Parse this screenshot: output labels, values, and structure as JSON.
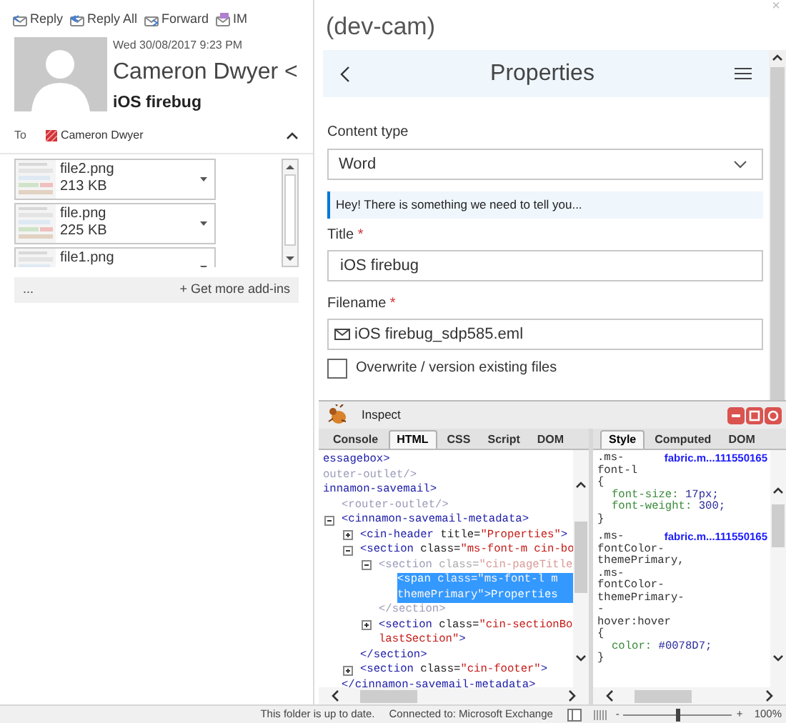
{
  "toolbar": [
    {
      "kind": "reply",
      "label": "Reply"
    },
    {
      "kind": "reply-all",
      "label": "Reply All"
    },
    {
      "kind": "forward",
      "label": "Forward"
    },
    {
      "kind": "im",
      "label": "IM"
    }
  ],
  "message": {
    "date": "Wed 30/08/2017 9:23 PM",
    "sender": "Cameron Dwyer <",
    "subject": "iOS firebug",
    "to_label": "To",
    "recipient": "Cameron Dwyer"
  },
  "attachments": [
    {
      "name": "file2.png",
      "size": "213 KB"
    },
    {
      "name": "file.png",
      "size": "225 KB"
    },
    {
      "name": "file1.png"
    }
  ],
  "addins": {
    "more": "...",
    "label": "+ Get more add-ins"
  },
  "addin_pane": {
    "title": "(dev-cam)",
    "close": "×",
    "header": "Properties",
    "fields": [
      {
        "kind": "select",
        "label": "Content type",
        "value": "Word"
      },
      {
        "kind": "message",
        "text": "Hey! There is something we need to tell you..."
      },
      {
        "kind": "text",
        "label": "Title",
        "required_mark": "*",
        "value": "iOS firebug"
      },
      {
        "kind": "file",
        "label": "Filename",
        "required_mark": "*",
        "value": "iOS firebug_sdp585.eml"
      },
      {
        "kind": "checkbox",
        "label": "Overwrite / version existing files",
        "checked": false
      }
    ]
  },
  "firebug": {
    "title": "Inspect",
    "tabs": [
      {
        "label": "Console",
        "selected": false
      },
      {
        "label": "HTML",
        "selected": true
      },
      {
        "label": "CSS",
        "selected": false
      },
      {
        "label": "Script",
        "selected": false
      },
      {
        "label": "DOM",
        "selected": false
      }
    ],
    "side_tabs": [
      {
        "label": "Style",
        "selected": true
      },
      {
        "label": "Computed",
        "selected": false
      },
      {
        "label": "DOM",
        "selected": false
      }
    ],
    "tree": [
      {
        "dim": false,
        "selected": false,
        "lines": [
          [
            {
              "kind": "tag",
              "text": "essagebox>"
            }
          ]
        ]
      },
      {
        "dim": true,
        "selected": false,
        "lines": [
          [
            {
              "kind": "tag",
              "text": "outer-outlet/>"
            }
          ]
        ]
      },
      {
        "dim": false,
        "selected": false,
        "lines": [
          [
            {
              "kind": "tag",
              "text": "innamon-savemail>"
            }
          ]
        ],
        "children": [
          {
            "dim": true,
            "selected": false,
            "lines": [
              [
                {
                  "kind": "tag",
                  "text": "<router-outlet/>"
                }
              ]
            ]
          },
          {
            "dim": false,
            "selected": false,
            "expanded": true,
            "lines": [
              [
                {
                  "kind": "tag",
                  "text": "<cinnamon-savemail-metadata>"
                }
              ]
            ],
            "close": [
              {
                "kind": "tag",
                "text": "</cinnamon-savemail-metadata>"
              }
            ],
            "children": [
              {
                "dim": false,
                "selected": false,
                "expanded": false,
                "lines": [
                  [
                    {
                      "kind": "tag",
                      "text": "<cin-header "
                    },
                    {
                      "kind": "attr",
                      "text": "title="
                    },
                    {
                      "kind": "value",
                      "text": "\"Properties\""
                    },
                    {
                      "kind": "tag",
                      "text": ">"
                    }
                  ]
                ]
              },
              {
                "dim": false,
                "selected": false,
                "expanded": true,
                "lines": [
                  [
                    {
                      "kind": "tag",
                      "text": "<section "
                    },
                    {
                      "kind": "attr",
                      "text": "class="
                    },
                    {
                      "kind": "value",
                      "text": "\"ms-font-m cin-bo"
                    }
                  ]
                ],
                "close": [
                  {
                    "kind": "tag",
                    "text": "</section>"
                  }
                ],
                "children": [
                  {
                    "dim": true,
                    "selected": false,
                    "expanded": true,
                    "lines": [
                      [
                        {
                          "kind": "tag",
                          "text": "<section "
                        },
                        {
                          "kind": "attr",
                          "text": "class="
                        },
                        {
                          "kind": "value",
                          "text": "\"cin-pageTitle"
                        }
                      ]
                    ],
                    "close": [
                      {
                        "kind": "tag",
                        "text": "</section>"
                      }
                    ],
                    "children": [
                      {
                        "dim": false,
                        "selected": true,
                        "lines": [
                          [
                            {
                              "kind": "tag",
                              "text": "<span "
                            },
                            {
                              "kind": "attr",
                              "text": "class="
                            },
                            {
                              "kind": "value",
                              "text": "\"ms-font-l m"
                            }
                          ],
                          [
                            {
                              "kind": "value",
                              "text": "themePrimary\""
                            },
                            {
                              "kind": "tag",
                              "text": ">"
                            },
                            {
                              "kind": "text",
                              "text": "Properties"
                            }
                          ]
                        ]
                      }
                    ]
                  },
                  {
                    "dim": false,
                    "selected": false,
                    "expanded": false,
                    "lines": [
                      [
                        {
                          "kind": "tag",
                          "text": "<section "
                        },
                        {
                          "kind": "attr",
                          "text": "class="
                        },
                        {
                          "kind": "value",
                          "text": "\"cin-sectionBo"
                        }
                      ],
                      [
                        {
                          "kind": "value",
                          "text": "lastSection\""
                        },
                        {
                          "kind": "tag",
                          "text": ">"
                        }
                      ]
                    ]
                  }
                ]
              },
              {
                "dim": false,
                "selected": false,
                "expanded": false,
                "lines": [
                  [
                    {
                      "kind": "tag",
                      "text": "<section "
                    },
                    {
                      "kind": "attr",
                      "text": "class="
                    },
                    {
                      "kind": "value",
                      "text": "\"cin-footer\""
                    },
                    {
                      "kind": "tag",
                      "text": ">"
                    }
                  ]
                ]
              }
            ]
          }
        ]
      }
    ],
    "style_rules": [
      {
        "source": "fabric.m...111550165",
        "selector_lines": [
          ".ms-",
          "font-l"
        ],
        "open": "{",
        "close": "}",
        "declarations": [
          {
            "property": "font-size:",
            "value": "17px;"
          },
          {
            "property": "font-weight:",
            "value": "300;"
          }
        ]
      },
      {
        "source": "fabric.m...111550165",
        "selector_lines": [
          ".ms-",
          "fontColor-",
          "themePrimary,",
          ".ms-",
          "fontColor-",
          "themePrimary-",
          "-",
          "hover:hover"
        ],
        "open": "{",
        "close": "}",
        "declarations": [
          {
            "property": "color:",
            "value": "#0078D7;"
          }
        ]
      }
    ]
  },
  "status_bar": {
    "sync": "This folder is up to date.",
    "connection": "Connected to: Microsoft Exchange",
    "zoom_slider": {
      "level": 0.5
    },
    "minus": "-",
    "plus": "+",
    "zoom": "100%"
  }
}
